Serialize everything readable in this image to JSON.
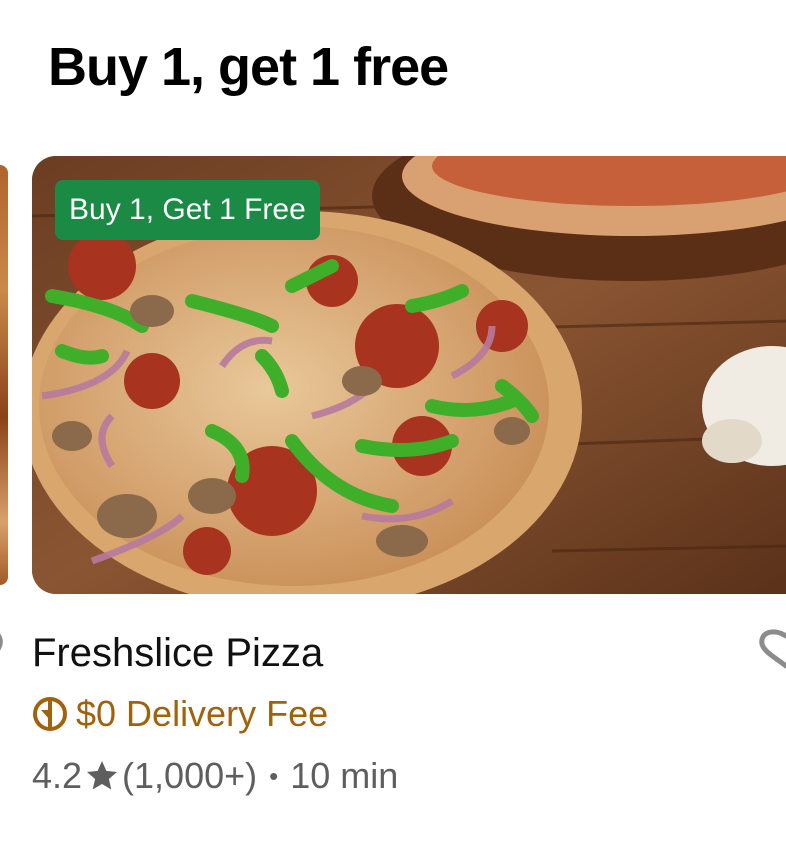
{
  "section": {
    "title": "Buy 1, get 1 free"
  },
  "card": {
    "promo_badge": "Buy 1, Get 1 Free",
    "store_name": "Freshslice Pizza",
    "delivery_fee": "$0 Delivery Fee",
    "rating": "4.2",
    "review_count": "(1,000+)",
    "separator": "•",
    "eta": "10 min",
    "image_icon": "pizza-photo",
    "fee_icon": "delivery-badge-icon",
    "favorite_icon": "heart-outline-icon"
  },
  "colors": {
    "badge_bg": "#1a8a45",
    "fee_text": "#a0620c",
    "meta_text": "#5e5e5e"
  }
}
